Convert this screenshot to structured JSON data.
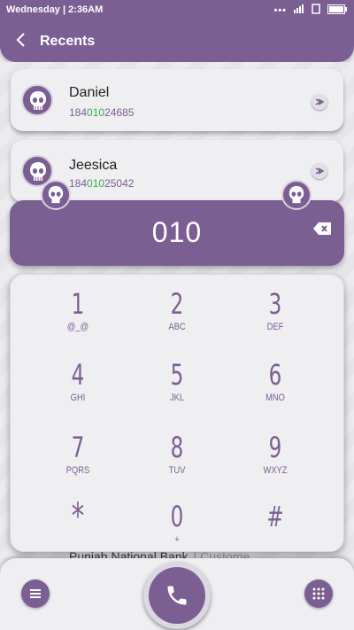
{
  "status_bar": {
    "time": "Wednesday | 2:36AM"
  },
  "header": {
    "title": "Recents"
  },
  "recents": [
    {
      "name": "Daniel",
      "number_pre": "184",
      "number_match": "010",
      "number_post": "24685"
    },
    {
      "name": "Jeesica",
      "number_pre": "184",
      "number_match": "010",
      "number_post": "25042"
    }
  ],
  "dialer": {
    "input_value": "010"
  },
  "keypad": {
    "keys": [
      {
        "digit": "1",
        "letters": "@_@"
      },
      {
        "digit": "2",
        "letters": "ABC"
      },
      {
        "digit": "3",
        "letters": "DEF"
      },
      {
        "digit": "4",
        "letters": "GHI"
      },
      {
        "digit": "5",
        "letters": "JKL"
      },
      {
        "digit": "6",
        "letters": "MNO"
      },
      {
        "digit": "7",
        "letters": "PQRS"
      },
      {
        "digit": "8",
        "letters": "TUV"
      },
      {
        "digit": "9",
        "letters": "WXYZ"
      },
      {
        "digit": "*",
        "letters": ""
      },
      {
        "digit": "0",
        "letters": "+"
      },
      {
        "digit": "#",
        "letters": ""
      }
    ]
  },
  "peek": {
    "name": "Punjab National Bank",
    "sub": "| Custome"
  },
  "colors": {
    "accent": "#7b5f93",
    "match": "#2eb34c",
    "background": "#e9e8ec"
  },
  "icons": {
    "back": "chevron-left-icon",
    "backspace": "backspace-icon",
    "menu": "menu-icon",
    "call": "phone-icon",
    "dialpad": "dialpad-icon"
  }
}
